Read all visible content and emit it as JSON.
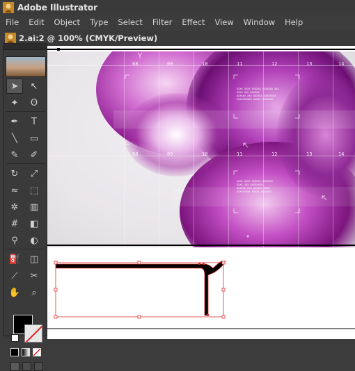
{
  "app": {
    "title": "Adobe Illustrator"
  },
  "menu": [
    "File",
    "Edit",
    "Object",
    "Type",
    "Select",
    "Filter",
    "Effect",
    "View",
    "Window",
    "Help"
  ],
  "document": {
    "title": "2.ai:2 @ 100% (CMYK/Preview)"
  },
  "artwork": {
    "column_numbers_top": [
      "08",
      "09",
      "10",
      "11",
      "12",
      "13",
      "14"
    ],
    "column_numbers_mid": [
      "08",
      "09",
      "10",
      "11",
      "12",
      "13",
      "14"
    ],
    "caption_1": "XXXX XXXX XXXXXX XXXXXXX XXX\nXXXX XXX XXXXXX\nXXXXXX XXX XXXXXX XXXXXXXX\nXXXXXXXXXX XXXXX XXXXXXX",
    "caption_2": "XXXX XXXX XXXXXX XXXXXXX\nXXXX XXX XXXXXXXX\nXXXXXX XXX XXXXXX XXXX\nXXXXXXXXX XXXXX XXXXXXX"
  },
  "toolbox": {
    "tools": [
      [
        "selection-tool-icon",
        "direct-selection-tool-icon"
      ],
      [
        "magic-wand-tool-icon",
        "lasso-tool-icon"
      ],
      [
        "pen-tool-icon",
        "type-tool-icon"
      ],
      [
        "line-segment-tool-icon",
        "rectangle-tool-icon"
      ],
      [
        "paintbrush-tool-icon",
        "pencil-tool-icon"
      ],
      [
        "rotate-tool-icon",
        "scale-tool-icon"
      ],
      [
        "warp-tool-icon",
        "free-transform-tool-icon"
      ],
      [
        "symbol-sprayer-tool-icon",
        "column-graph-tool-icon"
      ],
      [
        "mesh-tool-icon",
        "gradient-tool-icon"
      ],
      [
        "eyedropper-tool-icon",
        "blend-tool-icon"
      ],
      [
        "live-paint-bucket-tool-icon",
        "live-paint-selection-tool-icon"
      ],
      [
        "slice-tool-icon",
        "scissors-tool-icon"
      ],
      [
        "hand-tool-icon",
        "zoom-tool-icon"
      ]
    ],
    "fill_color": "#000000",
    "stroke_color": "none"
  },
  "colors": {
    "chrome": "#3c3c3c",
    "selection": "#e03030",
    "artwork_purple": "#9b1a9c"
  }
}
